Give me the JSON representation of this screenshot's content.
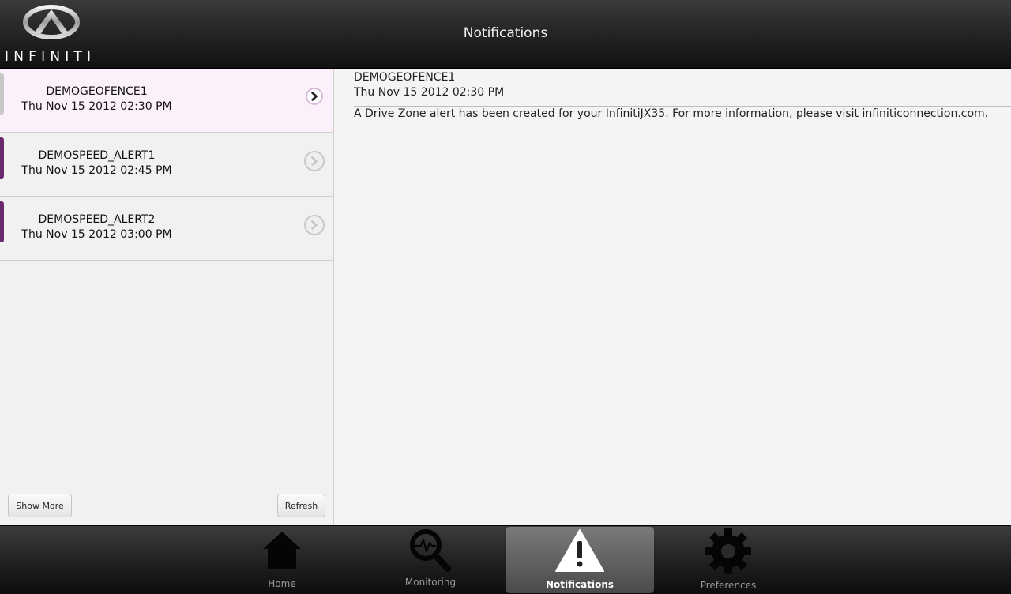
{
  "header": {
    "brand": "INFINITI",
    "title": "Notifications"
  },
  "list": {
    "items": [
      {
        "name": "DEMOGEOFENCE1",
        "datetime": "Thu Nov 15 2012 02:30 PM",
        "selected": true
      },
      {
        "name": "DEMOSPEED_ALERT1",
        "datetime": "Thu Nov 15 2012 02:45 PM",
        "selected": false
      },
      {
        "name": "DEMOSPEED_ALERT2",
        "datetime": "Thu Nov 15 2012 03:00 PM",
        "selected": false
      }
    ],
    "show_more_label": "Show More",
    "refresh_label": "Refresh"
  },
  "detail": {
    "name": "DEMOGEOFENCE1",
    "datetime": "Thu Nov 15 2012 02:30 PM",
    "message": "A Drive Zone alert has been created for your InfinitiJX35. For more information, please visit infiniticonnection.com."
  },
  "tabs": [
    {
      "label": "Home",
      "icon": "home-icon"
    },
    {
      "label": "Monitoring",
      "icon": "monitoring-icon"
    },
    {
      "label": "Notifications",
      "icon": "warning-icon",
      "active": true
    },
    {
      "label": "Preferences",
      "icon": "gear-icon"
    }
  ],
  "colors": {
    "accent": "#6c2a6e",
    "selected_row": "#fcf1fb"
  }
}
